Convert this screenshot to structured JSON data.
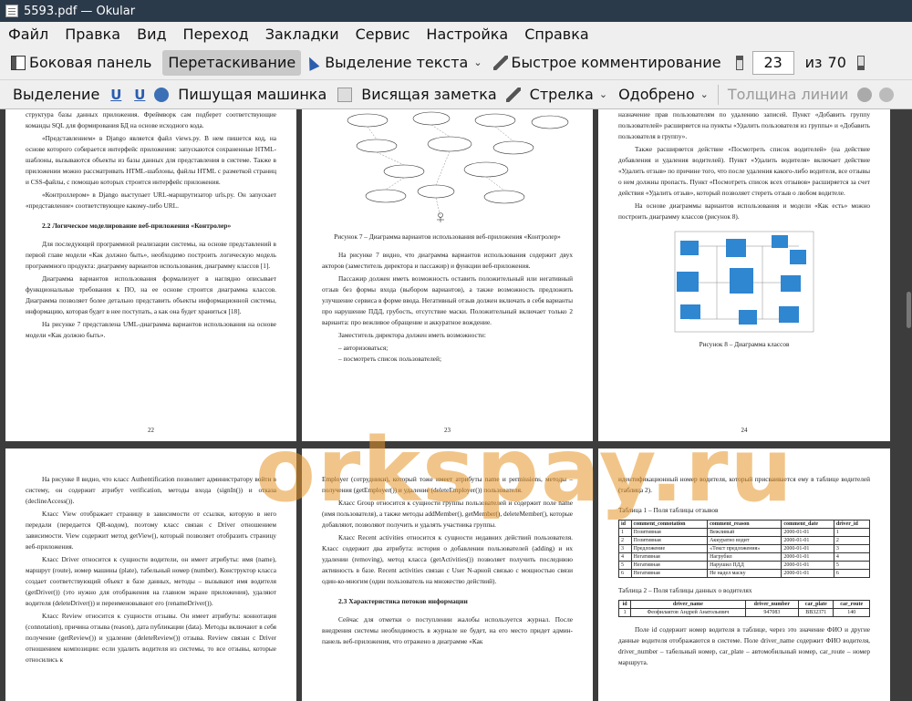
{
  "window": {
    "title": "5593.pdf  — Okular"
  },
  "menu": [
    "Файл",
    "Правка",
    "Вид",
    "Переход",
    "Закладки",
    "Сервис",
    "Настройка",
    "Справка"
  ],
  "toolbar1": {
    "sidebar": "Боковая панель",
    "drag": "Перетаскивание",
    "text_select": "Выделение текста",
    "quick_comment": "Быстрое комментирование",
    "page_current": "23",
    "page_of": "из",
    "page_total": "70"
  },
  "toolbar2": {
    "highlight": "Выделение",
    "u1": "U",
    "u2": "U",
    "typewriter": "Пишущая машинка",
    "popup_note": "Висящая заметка",
    "arrow": "Стрелка",
    "approved": "Одобрено",
    "line_width": "Толщина линии"
  },
  "pages": {
    "p22": {
      "para1": "структура базы данных приложения. Фреймворк сам подберет соответствующие команды SQL для формирования БД на основе исходного кода.",
      "para2": "«Представлением» в Django является файл views.py. В нем пишется код, на основе которого собирается интерфейс приложения: запускаются сохраненные HTML-шаблоны, вызываются объекты из базы данных для представления в системе. Также в приложении можно рассматривать HTML-шаблоны, файлы HTML с разметкой страниц и CSS-файлы, с помощью которых строится интерфейс приложения.",
      "para3": "«Контроллером» в Django выступает URL-маршрутизатор urls.py. Он запускает «представление» соответствующее какому-либо URL.",
      "heading": "2.2 Логическое моделирование веб-приложения «Контролер»",
      "para4": "Для последующей программной реализации системы, на основе представлений в первой главе модели «Как должно быть», необходимо построить логическую модель программного продукта: диаграмму вариантов использования, диаграмму классов [1].",
      "para5": "Диаграмма вариантов использования формализует в наглядно описывает функциональные требования к ПО, на ее основе строится диаграмма классов. Диаграмма позволяет более детально представить объекты информационной системы, информацию, которая будет в нее поступать, а как она будет храниться [18].",
      "para6": "На рисунке 7 представлена UML-диаграмма вариантов использования на основе модели «Как должно быть».",
      "num": "22"
    },
    "p23": {
      "caption": "Рисунок 7 – Диаграмма вариантов использования веб-приложения «Контролер»",
      "para1": "На рисунке 7 видно, что диаграмма вариантов использования содержит двух акторов (заместитель директора и пассажир) и функции веб-приложения.",
      "para2": "Пассажир должен иметь возможность оставить положительный или негативный отзыв без формы входа (выбором вариантов), а также возможность предложить улучшение сервиса в форме ввода. Негативный отзыв должен включать в себя варианты про нарушение ПДД, грубость, отсутствие маски. Положительный включает только 2 варианта: про вежливое обращение и аккуратное вождение.",
      "para3": "Заместитель директора должен иметь возможности:",
      "item1": "–  авторизоваться;",
      "item2": "–  посмотреть список пользователей;",
      "num": "23"
    },
    "p24": {
      "para1": "назначение прав пользователям по удалению записей. Пункт «Добавить группу пользователей» расширяется на пункты «Удалить пользователя из группы» и «Добавить пользователя в группу».",
      "para2": "Также расширяется действие «Посмотреть список водителей» (на действие добавления и удаления водителей). Пункт «Удалить водителя» включает действие «Удалить отзыв» по причине того, что после удаления какого-либо водителя, все отзывы о нем должны пропасть. Пункт «Посмотреть список всех отзывов» расширяется за счет действия «Удалить отзыв», который позволяет стереть отзыв о любом водителе.",
      "para3": "На основе диаграммы вариантов использования и модели «Как есть» можно построить диаграмму классов (рисунок 8).",
      "caption": "Рисунок 8 – Диаграмма классов",
      "num": "24"
    },
    "p25": {
      "para1": "На рисунке 8 видно, что класс Authentification позволяет администратору войти в систему, он содержит атрибут verification, методы входа (signIn()) и отказа (declineAccess()).",
      "para2": "Класс View отображает страницу в зависимости от ссылки, которую в него передали (передается QR-кодом), поэтому класс связан с Driver отношением зависимости. View содержит метод getView(), который позволяет отобразить страницу веб-приложения.",
      "para3": "Класс Driver относится к сущности водители, он имеет атрибуты: имя (name), маршрут (route), номер машины (plate), табельный номер (number). Конструктор класса создает соответствующий объект в базе данных, методы – вызывают имя водителя (getDriver()) (это нужно для отображения на главном экране приложения), удаляют водителя (deleteDriver()) и переименовывают его (renameDriver()).",
      "para4": "Класс Review относится к сущности отзывы. Он имеет атрибуты: коннотация (connotation), причина отзыва (reason), дата публикации (data). Методы включают в себя получение (getReview()) и удаление (deleteReview()) отзыва. Review связан с Driver отношением композиции: если удалить водителя из системы, то все отзывы, которые относились к"
    },
    "p26": {
      "para1": "Employer (сотрудники), который тоже имеет атрибуты name и permissions, методы – получения (getEmployer()) и удаление (deleteEmployer()) пользователя.",
      "para2": "Класс Group относится к сущности группы пользователей и содержит поле name (имя пользователя), а также методы addMember(), getMember(), deleteMember(), которые добавляют, позволяют получить и удалять участника группы.",
      "para3": "Класс Recent activities относится к сущности недавних действий пользователя. Класс содержит два атрибута: история о добавлении пользователей (adding) и их удалении (removing), метод класса (getActivities()) позволяет получить последнюю активность в базе. Recent activities связан с User N-арной связью с мощностью связи один-ко-многим (один пользователь на множество действий).",
      "heading": "2.3 Характеристика потоков информации",
      "para4": "Сейчас для отметки о поступлении жалобы используется журнал. После внедрения системы необходимость в журнале не будет, на его место придет админ-панель веб-приложения, что отражено в диаграмме «Как"
    },
    "p27": {
      "para1": "идентификационный номер водителя, который присваивается ему в таблице водителей (таблица 2).",
      "table1_caption": "Таблица 1 – Поля таблицы отзывов",
      "table1_headers": [
        "id",
        "comment_connotation",
        "comment_reason",
        "comment_date",
        "driver_id"
      ],
      "table1_rows": [
        [
          "1",
          "Позитивная",
          "Вежливый",
          "2000-01-01",
          "1"
        ],
        [
          "2",
          "Позитивная",
          "Аккуратно водит",
          "2000-01-01",
          "2"
        ],
        [
          "3",
          "Предложение",
          "«Текст предложения»",
          "2000-01-01",
          "3"
        ],
        [
          "4",
          "Негативная",
          "Нагрубил",
          "2000-01-01",
          "4"
        ],
        [
          "5",
          "Негативная",
          "Нарушил ПДД",
          "2000-01-01",
          "5"
        ],
        [
          "6",
          "Негативная",
          "Не надел маску",
          "2000-01-01",
          "6"
        ]
      ],
      "table2_caption": "Таблица 2 – Поля таблицы данных о водителях",
      "table2_headers": [
        "id",
        "driver_name",
        "driver_number",
        "car_plate",
        "car_route"
      ],
      "table2_rows": [
        [
          "1",
          "Феофилактов Андрей Анатольевич",
          "947083",
          "ВВ32371",
          "140"
        ]
      ],
      "para2": "Поле id содержит номер водителя в таблице, через это значение ФИО и другие данные водителя отображаются в системе. Поле driver_name содержит ФИО водителя, driver_number – табельный номер, car_plate – автомобильный номер, car_route – номер маршрута."
    }
  },
  "watermark": "orkspay.ru"
}
